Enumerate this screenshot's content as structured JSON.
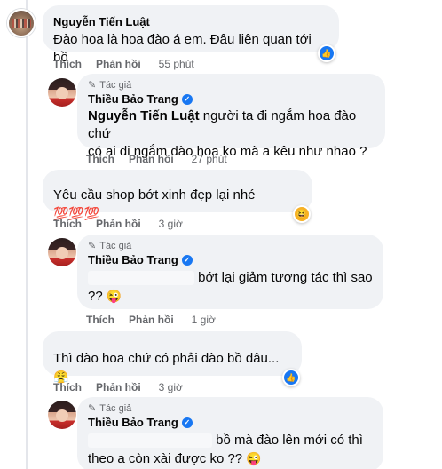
{
  "comments": [
    {
      "author": "Nguyễn Tiến Luật",
      "text": "Đào hoa là hoa đào á em. Đâu liên quan tới bồ",
      "actions": {
        "like": "Thích",
        "reply": "Phản hồi",
        "time": "55 phút"
      },
      "reaction": "like",
      "replies": [
        {
          "badge": "Tác giả",
          "author": "Thiều Bảo Trang",
          "mention": "Nguyễn Tiến Luật",
          "text_line1": "người ta đi ngắm hoa đào chứ",
          "text_line2": "có ai đi ngắm đào hoa ko mà a kêu như nhao ?",
          "actions": {
            "like": "Thích",
            "reply": "Phản hồi",
            "time": "27 phút"
          }
        }
      ]
    },
    {
      "author": "",
      "text": "Yêu cầu shop bớt xinh đẹp lại nhé",
      "emoji": "💯💯💯",
      "actions": {
        "like": "Thích",
        "reply": "Phản hồi",
        "time": "3 giờ"
      },
      "reaction": "haha",
      "replies": [
        {
          "badge": "Tác giả",
          "author": "Thiều Bảo Trang",
          "text_line1": "bớt lại giảm tương tác thì sao",
          "text_line2": "??",
          "emoji": "😜",
          "actions": {
            "like": "Thích",
            "reply": "Phản hồi",
            "time": "1 giờ"
          }
        }
      ]
    },
    {
      "author": "",
      "text": "Thì đào hoa chứ có phải đào bồ đâu...",
      "emoji": "😤",
      "actions": {
        "like": "Thích",
        "reply": "Phản hồi",
        "time": "3 giờ"
      },
      "reaction": "like",
      "replies": [
        {
          "badge": "Tác giả",
          "author": "Thiều Bảo Trang",
          "text_line1": "bồ mà đào lên mới có thì",
          "text_line2": "theo a còn xài được ko ??",
          "emoji": "😜"
        }
      ]
    }
  ],
  "icons": {
    "pencil": "✎",
    "verified": "✓",
    "like": "👍",
    "haha": "😆"
  },
  "colors": {
    "bubble": "#f0f2f5",
    "secondary_text": "#65676b",
    "verified_blue": "#1877f2"
  }
}
